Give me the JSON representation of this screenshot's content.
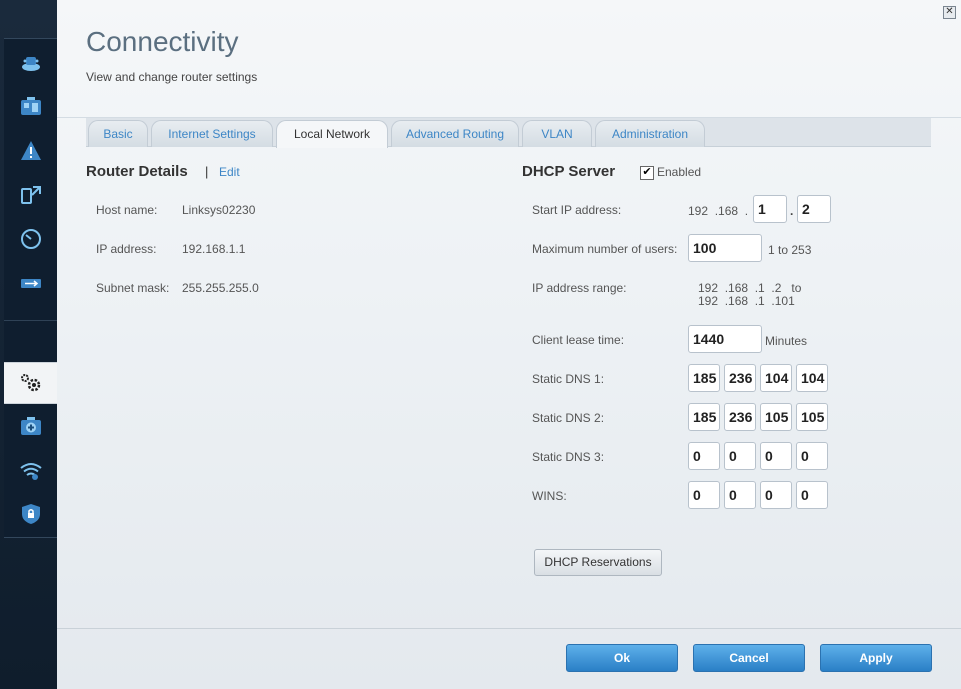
{
  "header": {
    "title": "Connectivity",
    "subtitle": "View and change router settings"
  },
  "sidebar": {
    "items": [
      {
        "icon": "router-icon"
      },
      {
        "icon": "devices-icon"
      },
      {
        "icon": "troubleshooting-icon"
      },
      {
        "icon": "network-map-icon"
      },
      {
        "icon": "speed-test-icon"
      },
      {
        "icon": "usb-storage-icon"
      },
      {
        "icon": "connectivity-gear-icon",
        "active": true
      },
      {
        "icon": "media-prioritization-icon"
      },
      {
        "icon": "wireless-icon"
      },
      {
        "icon": "security-shield-icon"
      }
    ]
  },
  "tabs": [
    {
      "label": "Basic"
    },
    {
      "label": "Internet Settings"
    },
    {
      "label": "Local Network",
      "active": true
    },
    {
      "label": "Advanced Routing"
    },
    {
      "label": "VLAN"
    },
    {
      "label": "Administration"
    }
  ],
  "router_details": {
    "title": "Router Details",
    "separator": "|",
    "edit_label": "Edit",
    "host_name_label": "Host name:",
    "host_name": "Linksys02230",
    "ip_label": "IP address:",
    "ip": "192.168.1.1",
    "subnet_label": "Subnet mask:",
    "subnet": "255.255.255.0"
  },
  "dhcp": {
    "title": "DHCP Server",
    "enabled_label": "Enabled",
    "enabled_check": "✔",
    "start_ip_label": "Start IP address:",
    "start_ip_fixed": "192  .168  .",
    "start_ip_oct3": "1",
    "start_ip_oct4": "2",
    "dot": ".",
    "max_users_label": "Maximum number of users:",
    "max_users": "100",
    "max_users_range": "1 to 253",
    "range_label": "IP address range:",
    "range_line1": "192  .168  .1  .2   to",
    "range_line2": "192  .168  .1  .101",
    "lease_label": "Client lease time:",
    "lease": "1440",
    "lease_unit": "Minutes",
    "dns1_label": "Static DNS 1:",
    "dns1": [
      "185",
      "236",
      "104",
      "104"
    ],
    "dns2_label": "Static DNS 2:",
    "dns2": [
      "185",
      "236",
      "105",
      "105"
    ],
    "dns3_label": "Static DNS 3:",
    "dns3": [
      "0",
      "0",
      "0",
      "0"
    ],
    "wins_label": "WINS:",
    "wins": [
      "0",
      "0",
      "0",
      "0"
    ],
    "reservations_label": "DHCP Reservations"
  },
  "footer": {
    "ok_label": "Ok",
    "cancel_label": "Cancel",
    "apply_label": "Apply"
  },
  "colors": {
    "accent": "#3d86c6",
    "sidebar": "#0f1e2f",
    "button_blue": "#2a7fc6"
  }
}
